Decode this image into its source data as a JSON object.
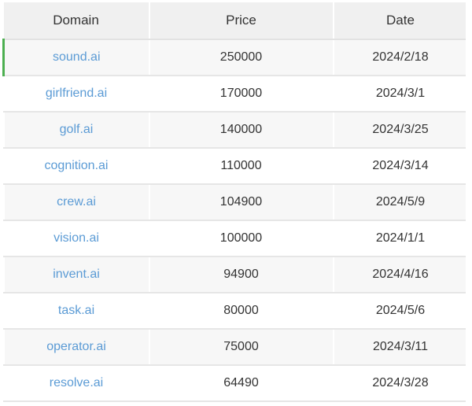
{
  "table": {
    "columns": [
      {
        "key": "domain",
        "label": "Domain"
      },
      {
        "key": "price",
        "label": "Price"
      },
      {
        "key": "date",
        "label": "Date"
      }
    ],
    "accent_color": "#4caf50",
    "link_color": "#5b9bd5",
    "header_bg": "#f0f0f0",
    "row_bg_odd": "#f7f7f7",
    "row_bg_even": "#ffffff",
    "rows": [
      {
        "domain": "sound.ai",
        "price": "250000",
        "date": "2024/2/18"
      },
      {
        "domain": "girlfriend.ai",
        "price": "170000",
        "date": "2024/3/1"
      },
      {
        "domain": "golf.ai",
        "price": "140000",
        "date": "2024/3/25"
      },
      {
        "domain": "cognition.ai",
        "price": "110000",
        "date": "2024/3/14"
      },
      {
        "domain": "crew.ai",
        "price": "104900",
        "date": "2024/5/9"
      },
      {
        "domain": "vision.ai",
        "price": "100000",
        "date": "2024/1/1"
      },
      {
        "domain": "invent.ai",
        "price": "94900",
        "date": "2024/4/16"
      },
      {
        "domain": "task.ai",
        "price": "80000",
        "date": "2024/5/6"
      },
      {
        "domain": "operator.ai",
        "price": "75000",
        "date": "2024/3/11"
      },
      {
        "domain": "resolve.ai",
        "price": "64490",
        "date": "2024/3/28"
      }
    ]
  }
}
